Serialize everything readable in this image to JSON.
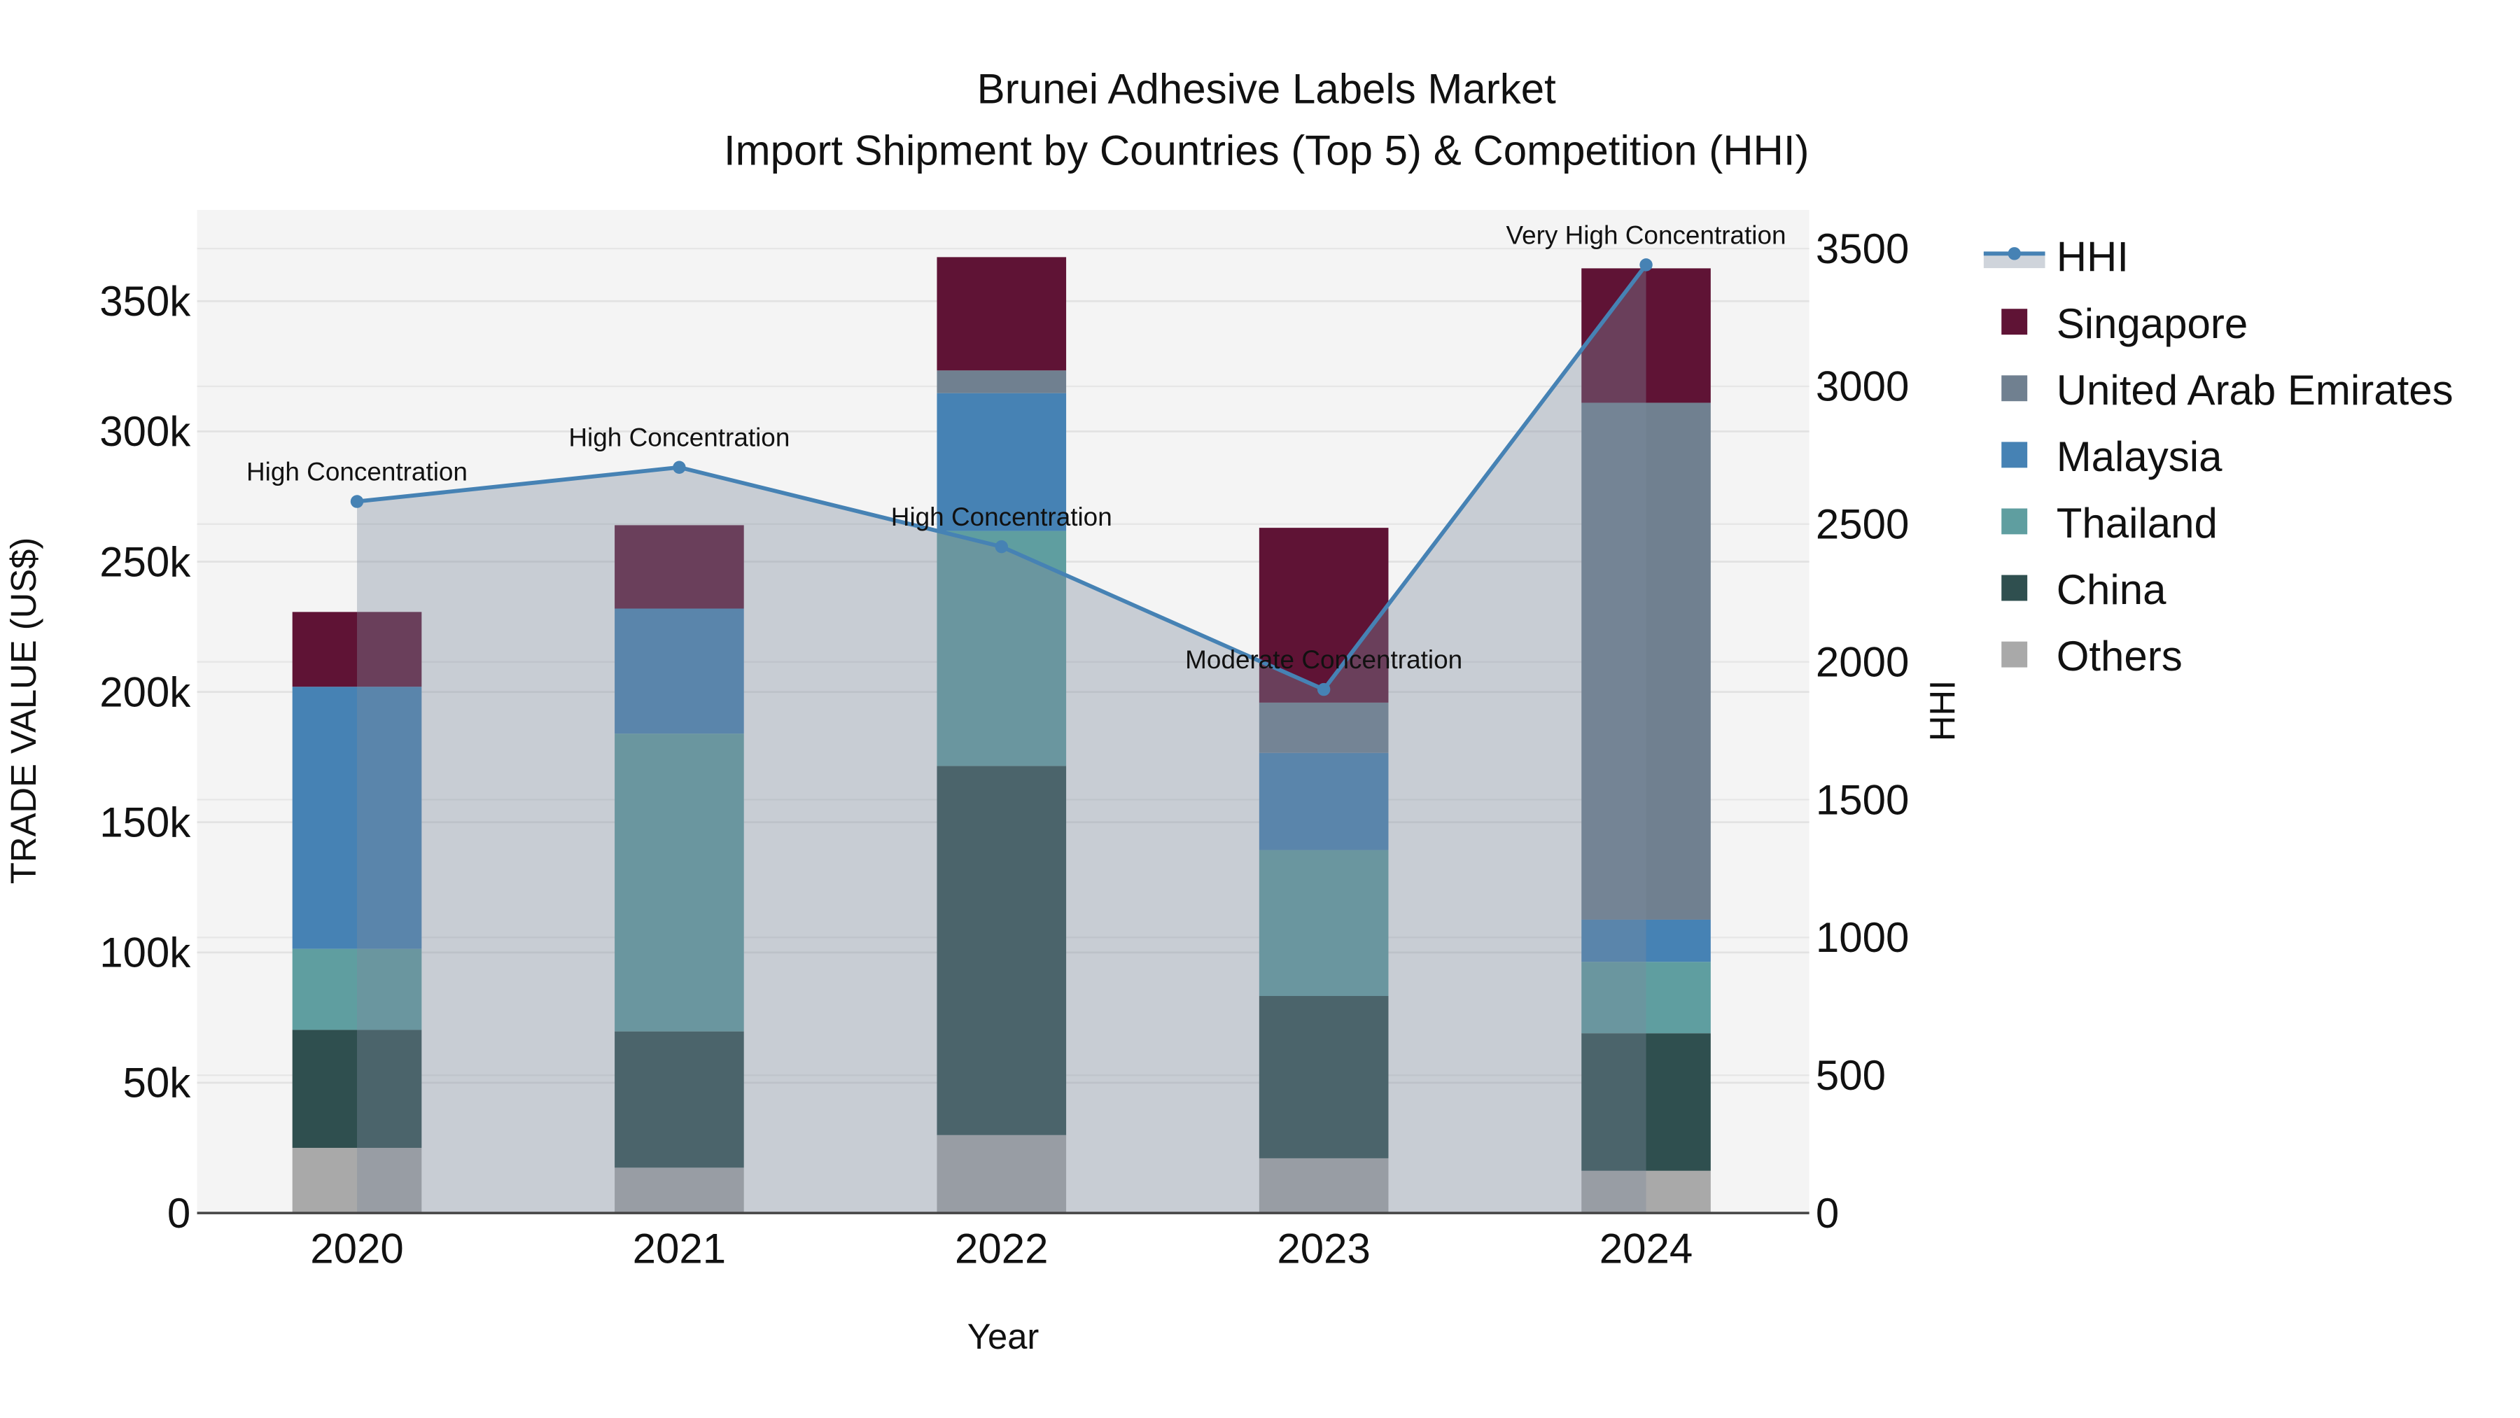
{
  "chart_data": {
    "type": "bar",
    "stacked": true,
    "title": "Brunei Adhesive Labels Market",
    "subtitle": "Import Shipment by Countries (Top 5) & Competition (HHI)",
    "xlabel": "Year",
    "ylabel": "TRADE VALUE (US$)",
    "y2label": "HHI",
    "categories": [
      "2020",
      "2021",
      "2022",
      "2023",
      "2024"
    ],
    "ylim": [
      0,
      385000
    ],
    "y2lim": [
      0,
      3640
    ],
    "yticks": [
      0,
      50000,
      100000,
      150000,
      200000,
      250000,
      300000,
      350000
    ],
    "ytick_labels": [
      "0",
      "50k",
      "100k",
      "150k",
      "200k",
      "250k",
      "300k",
      "350k"
    ],
    "y2ticks": [
      0,
      500,
      1000,
      1500,
      2000,
      2500,
      3000,
      3500
    ],
    "y2tick_labels": [
      "0",
      "500",
      "1000",
      "1500",
      "2000",
      "2500",
      "3000",
      "3500"
    ],
    "grid": true,
    "legend_position": "right",
    "series": [
      {
        "name": "Others",
        "color": "#a9a9a9",
        "values": [
          25000,
          17400,
          29900,
          21000,
          16200
        ]
      },
      {
        "name": "China",
        "color": "#2f4f4f",
        "values": [
          45300,
          52300,
          141700,
          62300,
          52800
        ]
      },
      {
        "name": "Thailand",
        "color": "#5f9ea0",
        "values": [
          31100,
          114300,
          90200,
          56000,
          27400
        ]
      },
      {
        "name": "Malaysia",
        "color": "#4682b4",
        "values": [
          100600,
          48000,
          52900,
          37300,
          16200
        ]
      },
      {
        "name": "United Arab Emirates",
        "color": "#708090",
        "values": [
          0,
          0,
          8700,
          19300,
          198400
        ]
      },
      {
        "name": "Singapore",
        "color": "#5f1335",
        "values": [
          28700,
          32000,
          43500,
          67100,
          51600
        ]
      }
    ],
    "line": {
      "name": "HHI",
      "color": "#4682b4",
      "values": [
        2582,
        2706,
        2418,
        1900,
        3441
      ],
      "annotations": [
        "High Concentration",
        "High Concentration",
        "High Concentration",
        "Moderate Concentration",
        "Very High Concentration"
      ]
    },
    "legend_order": [
      "HHI",
      "Singapore",
      "United Arab Emirates",
      "Malaysia",
      "Thailand",
      "China",
      "Others"
    ]
  }
}
